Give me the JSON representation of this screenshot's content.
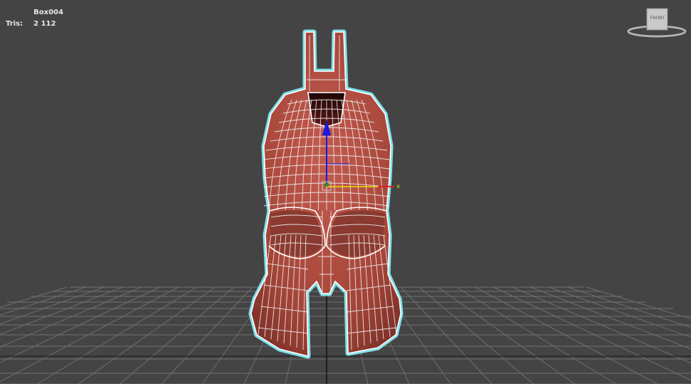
{
  "viewport": {
    "object_name": "Box004",
    "stats_label": "Tris:",
    "tris_count": "2 112",
    "viewcube_face": "FRONT",
    "gizmo_axis_x": "x"
  },
  "colors": {
    "background": "#444444",
    "grid": "#6f6f6f",
    "mesh_fill": "#a8493d",
    "wire": "#f2f2f2",
    "selection_outline": "#7fe0e8",
    "axis_x": "#e8e000",
    "axis_z": "#1a1ae0"
  }
}
